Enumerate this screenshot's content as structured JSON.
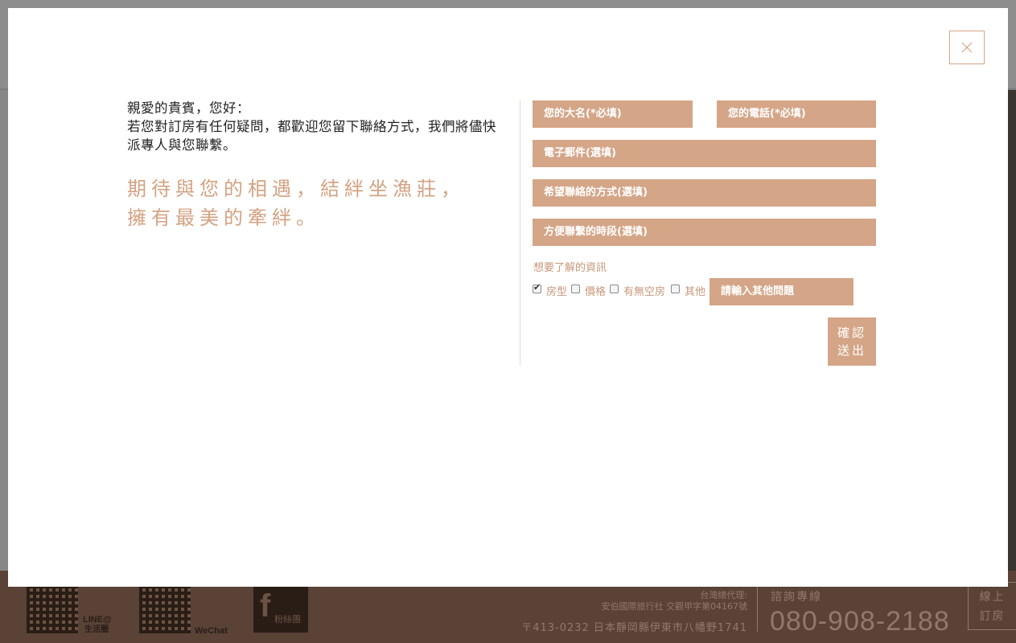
{
  "modal": {
    "intro_line1": "親愛的貴賓，您好：",
    "intro_line2": "若您對訂房有任何疑問，都歡迎您留下聯絡方式，我們將儘快派專人與您聯繫。",
    "tagline_line1": "期待與您的相遇，結絆坐漁莊，",
    "tagline_line2": "擁有最美的牽絆。",
    "close_icon": "close-icon"
  },
  "form": {
    "name_placeholder": "您的大名(*必填)",
    "phone_placeholder": "您的電話(*必填)",
    "email_placeholder": "電子郵件(選填)",
    "contact_method_placeholder": "希望聯絡的方式(選填)",
    "contact_time_placeholder": "方便聯繫的時段(選填)",
    "info_label": "想要了解的資訊",
    "options": [
      {
        "label": "房型",
        "checked": true
      },
      {
        "label": "價格",
        "checked": false
      },
      {
        "label": "有無空房",
        "checked": false
      },
      {
        "label": "其他",
        "checked": false
      }
    ],
    "other_placeholder": "請輸入其他問題",
    "submit_line1": "確認",
    "submit_line2": "送出"
  },
  "footer": {
    "line_label": "LINE@",
    "line_sub": "生活圈",
    "wechat_label": "WeChat",
    "fb_label": "粉絲團",
    "agent_line1": "台灣總代理:",
    "agent_line2": "安伯國際旅行社 交觀甲字第04167號",
    "address": "〒413-0232 日本靜岡縣伊東市八幡野1741",
    "hotline_label": "諮詢專線",
    "hotline_number": "080-908-2188",
    "booking_line1": "線上",
    "booking_line2": "訂房"
  },
  "colors": {
    "accent": "#d4a587",
    "accent_text": "#c9977a",
    "footer_bg": "#5a4236",
    "overlay": "#8a8a8a"
  }
}
